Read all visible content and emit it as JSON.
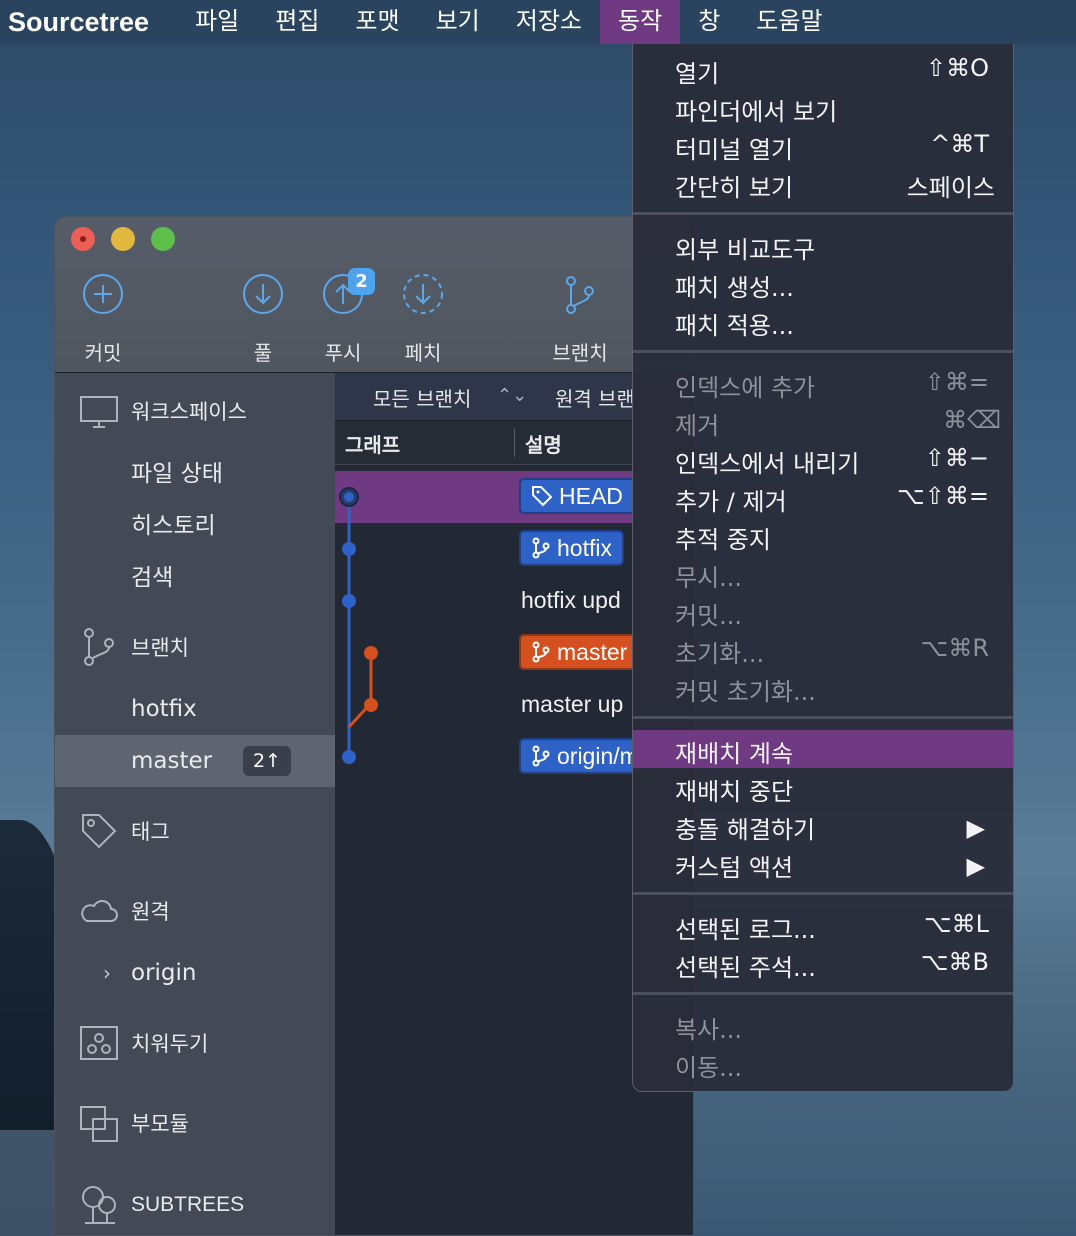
{
  "menubar": {
    "app_name": "Sourcetree",
    "items": [
      "파일",
      "편집",
      "포맷",
      "보기",
      "저장소",
      "동작",
      "창",
      "도움말"
    ],
    "active_index": 5
  },
  "toolbar": {
    "commit": "커밋",
    "pull": "풀",
    "push": "푸시",
    "push_badge": "2",
    "fetch": "페치",
    "branch": "브랜치"
  },
  "sidebar": {
    "workspace": "워크스페이스",
    "file_status": "파일 상태",
    "history": "히스토리",
    "search": "검색",
    "branches": "브랜치",
    "branch_hotfix": "hotfix",
    "branch_master": "master",
    "master_ahead": "2↑",
    "tags": "태그",
    "remotes": "원격",
    "origin": "origin",
    "stashes": "치워두기",
    "submodules": "부모듈",
    "subtrees": "SUBTREES"
  },
  "main": {
    "filter_all_branches": "모든 브랜치",
    "filter_remote": "원격 브랜",
    "col_graph": "그래프",
    "col_description": "설명",
    "commits": [
      {
        "type": "tag",
        "label": "HEAD"
      },
      {
        "type": "tag",
        "label": "hotfix"
      },
      {
        "type": "text",
        "label": "hotfix upd"
      },
      {
        "type": "tag",
        "label": "master"
      },
      {
        "type": "text",
        "label": "master up"
      },
      {
        "type": "tag",
        "label": "origin/m"
      }
    ]
  },
  "menu": {
    "items": [
      {
        "label": "열기",
        "shortcut": "⇧⌘O",
        "enabled": true
      },
      {
        "label": "파인더에서 보기",
        "shortcut": "",
        "enabled": true
      },
      {
        "label": "터미널 열기",
        "shortcut": "^⌘T",
        "enabled": true
      },
      {
        "label": "간단히 보기",
        "shortcut": "스페이스",
        "enabled": true
      },
      {
        "label": "외부 비교도구",
        "shortcut": "",
        "enabled": true
      },
      {
        "label": "패치 생성...",
        "shortcut": "",
        "enabled": true
      },
      {
        "label": "패치 적용...",
        "shortcut": "",
        "enabled": true
      },
      {
        "label": "인덱스에 추가",
        "shortcut": "⇧⌘=",
        "enabled": false
      },
      {
        "label": "제거",
        "shortcut": "⌘⌫",
        "enabled": false
      },
      {
        "label": "인덱스에서 내리기",
        "shortcut": "⇧⌘−",
        "enabled": true
      },
      {
        "label": "추가 / 제거",
        "shortcut": "⌥⇧⌘=",
        "enabled": true
      },
      {
        "label": "추적 중지",
        "shortcut": "",
        "enabled": true
      },
      {
        "label": "무시...",
        "shortcut": "",
        "enabled": false
      },
      {
        "label": "커밋...",
        "shortcut": "",
        "enabled": false
      },
      {
        "label": "초기화...",
        "shortcut": "⌥⌘R",
        "enabled": false
      },
      {
        "label": "커밋 초기화...",
        "shortcut": "",
        "enabled": false
      },
      {
        "label": "재배치 계속",
        "shortcut": "",
        "enabled": true,
        "selected": true
      },
      {
        "label": "재배치 중단",
        "shortcut": "",
        "enabled": true
      },
      {
        "label": "충돌 해결하기",
        "shortcut": "▶",
        "enabled": true
      },
      {
        "label": "커스텀 액션",
        "shortcut": "▶",
        "enabled": true
      },
      {
        "label": "선택된 로그...",
        "shortcut": "⌥⌘L",
        "enabled": true
      },
      {
        "label": "선택된 주석...",
        "shortcut": "⌥⌘B",
        "enabled": true
      },
      {
        "label": "복사...",
        "shortcut": "",
        "enabled": false
      },
      {
        "label": "이동...",
        "shortcut": "",
        "enabled": false
      }
    ]
  },
  "colors": {
    "accent_purple": "#6f3a82",
    "branch_blue": "#2f62c6",
    "branch_orange": "#d4501f"
  }
}
